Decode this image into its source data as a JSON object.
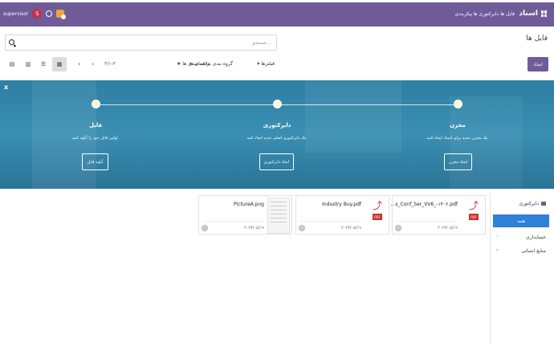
{
  "topbar": {
    "brand": "اسناد",
    "menu": [
      "فایل ها",
      "دایرکتوری ها",
      "پیکربندی"
    ],
    "user": "supervisor",
    "avatar_letter": "S"
  },
  "page": {
    "title": "فایل ها",
    "search_placeholder": "جستجو...",
    "create_label": "ایجاد",
    "filters_label": "فیلترها",
    "group_by_label": "گروه بندی بر مبنای",
    "favorites_label": "علاقه مندی ها",
    "pager": "۳/۱-۳"
  },
  "hero": {
    "close": "x",
    "steps": [
      {
        "title": "مخزن",
        "desc": "یک مخزن جدید برای اسناد ایجاد کنید.",
        "button": "ایجاد مخزن"
      },
      {
        "title": "دایرکتوری",
        "desc": "یک دایرکتوری اصلی جدید ایجاد کنید.",
        "button": "ایجاد دایرکتوری"
      },
      {
        "title": "فایل",
        "desc": "اولین فایل خود را آپلود کنید.",
        "button": "آپلود فایل"
      }
    ]
  },
  "sidebar": {
    "header": "دایرکتوری",
    "items": [
      {
        "label": "همه",
        "count": ""
      },
      {
        "label": "حسابداری",
        "count": "۱"
      },
      {
        "label": "منابع انسانی",
        "count": "۲"
      }
    ]
  },
  "files": [
    {
      "name": "...s_Conf_Ser_VV6_-۱۴۰۲.pdf",
      "date": "۲۰۲۳/۰۵/۱۹",
      "type": "pdf"
    },
    {
      "name": "Industry Buy.pdf",
      "date": "۲۰۲۳/۰۵/۱۹",
      "type": "pdf"
    },
    {
      "name": "PictureA.png",
      "date": "۲۰۲۳/۰۵/۱۹",
      "type": "image"
    }
  ],
  "colors": {
    "brand": "#6f5b97",
    "accent": "#2f80d8",
    "hero": "#2d7fa3",
    "pdf": "#c9302c"
  }
}
